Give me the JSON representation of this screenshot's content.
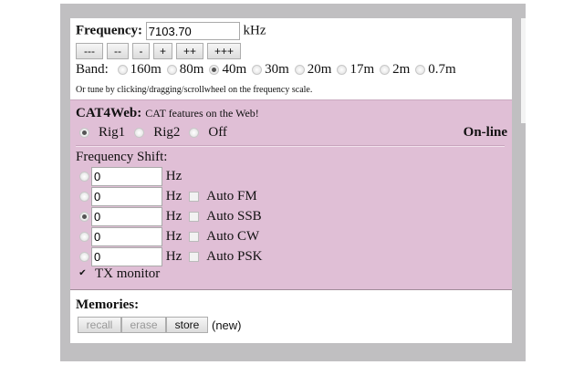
{
  "frequency": {
    "label": "Frequency:",
    "value": "7103.70",
    "unit": "kHz"
  },
  "tune_buttons": [
    "---",
    "--",
    "-",
    "+",
    "++",
    "+++"
  ],
  "band": {
    "label": "Band:",
    "options": [
      "160m",
      "80m",
      "40m",
      "30m",
      "20m",
      "17m",
      "2m",
      "0.7m"
    ],
    "selected": "40m"
  },
  "hint": "Or tune by clicking/dragging/scrollwheel on the frequency scale.",
  "cat": {
    "title": "CAT4Web:",
    "subtitle": "CAT features on the Web!",
    "rigs": [
      "Rig1",
      "Rig2",
      "Off"
    ],
    "selected_rig": "Rig1",
    "status": "On-line"
  },
  "shift": {
    "label": "Frequency Shift:",
    "unit": "Hz",
    "rows": [
      {
        "value": "0",
        "auto": "",
        "selected": false
      },
      {
        "value": "0",
        "auto": "Auto FM",
        "selected": false
      },
      {
        "value": "0",
        "auto": "Auto SSB",
        "selected": true
      },
      {
        "value": "0",
        "auto": "Auto CW",
        "selected": false
      },
      {
        "value": "0",
        "auto": "Auto PSK",
        "selected": false
      }
    ]
  },
  "tx_monitor": {
    "label": "TX monitor",
    "checked": true
  },
  "memories": {
    "label": "Memories:",
    "recall": "recall",
    "erase": "erase",
    "store": "store",
    "status": "(new)"
  },
  "colors": {
    "cat_bg": "#e0bfd6",
    "frame": "#c0bfc1"
  }
}
